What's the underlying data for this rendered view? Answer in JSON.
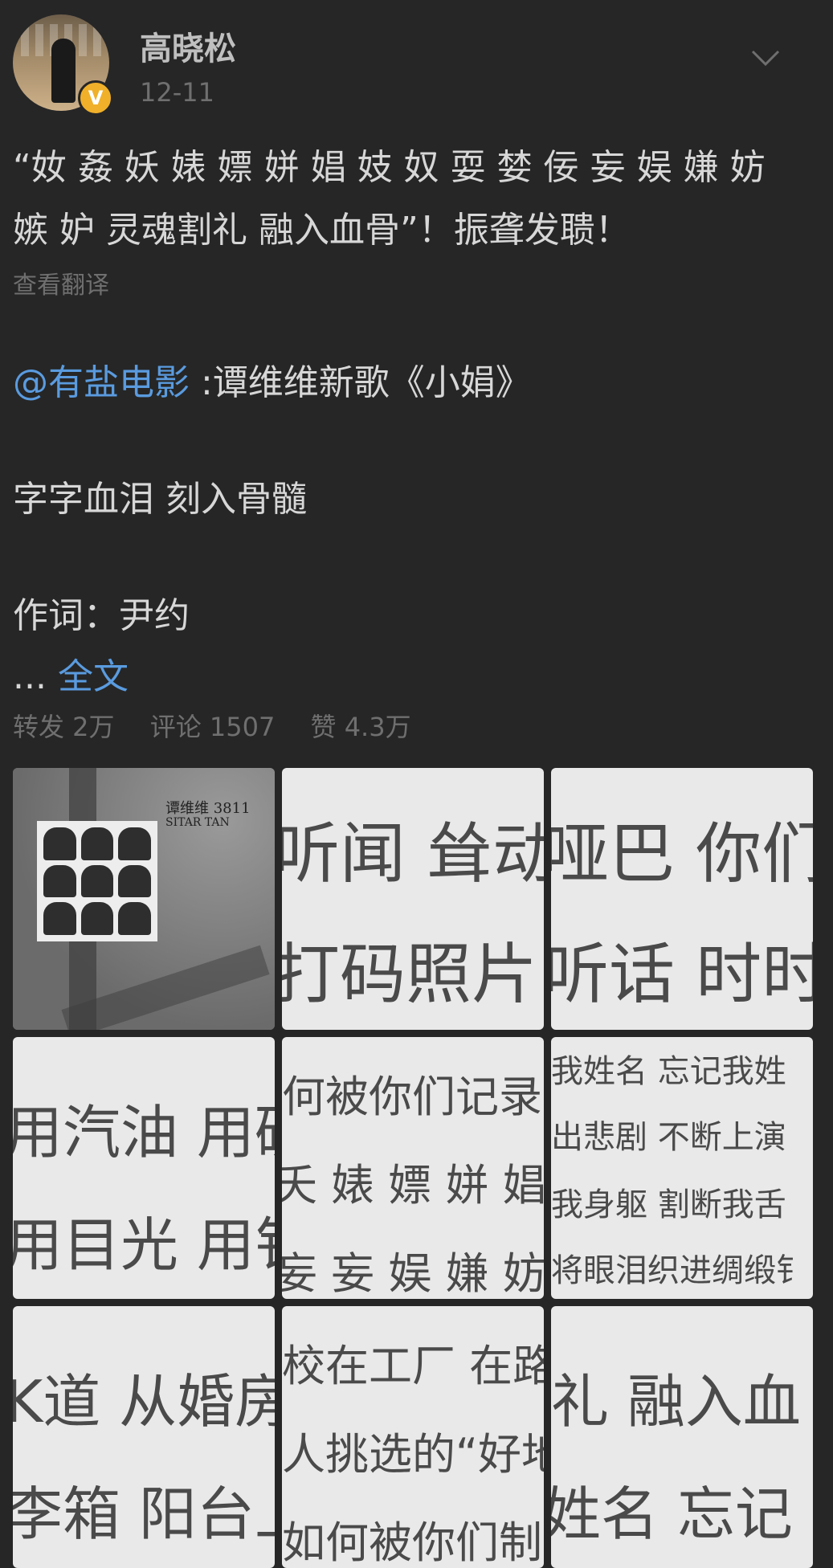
{
  "post": {
    "author": "高晓松",
    "date": "12-11",
    "verified_badge": "V",
    "text_line1": "“奻 姦 妖 婊 嫖 姘 娼 妓 奴 耍 婪 佞 妄 娱 嫌 妨",
    "text_line2": "嫉 妒 灵魂割礼 融入血骨”！振聋发聩！",
    "translate_link": "查看翻译",
    "mention": "@有盐电影",
    "mention_rest": " :谭维维新歌《小娟》",
    "line_blood": "字字血泪 刻入骨髓",
    "line_lyrics": "作词：尹约",
    "ellipsis": "...",
    "full_text_link": "全文"
  },
  "stats": {
    "repost": "转发 2万",
    "comment": "评论 1507",
    "like": "赞 4.3万"
  },
  "images": {
    "cover_title": "谭维维 3811",
    "cover_subtitle": "SITAR TAN",
    "tile2_l1": "听闻 耸动",
    "tile2_l2": "打码照片",
    "tile3_l1": "哑巴 你们",
    "tile3_l2": "听话 时时",
    "tile4_l1": "用汽油 用硫",
    "tile4_l2": "用目光 用钅",
    "tile5_l1": "何被你们记录",
    "tile5_l2": "夭 婊 嫖 姘 娼",
    "tile5_l3": "妄 妄 娱 嫌 妨",
    "tile6_l1": "我姓名 忘记我姓",
    "tile6_l2": "出悲剧 不断上演",
    "tile6_l3": "我身躯 割断我舌",
    "tile6_l4": "将眼泪织进绸缎钅",
    "tile7_l1": "K道 从婚房",
    "tile7_l2": "李箱 阳台上",
    "tile8_l1": "校在工厂  在路",
    "tile8_l2": "人挑选的“好地",
    "tile8_l3": "如何被你们制",
    "tile9_l1": "礼 融入血",
    "tile9_l2": "姓名 忘记"
  }
}
